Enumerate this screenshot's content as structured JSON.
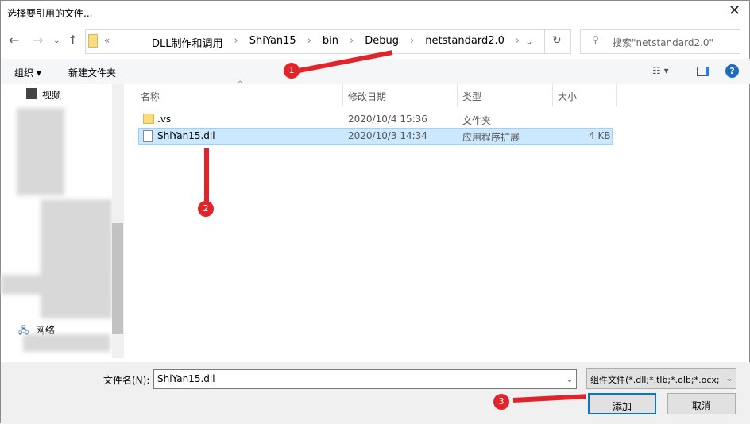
{
  "window": {
    "title": "选择要引用的文件..."
  },
  "address": {
    "overflow": "«",
    "crumbs": [
      "DLL制作和调用",
      "ShiYan15",
      "bin",
      "Debug",
      "netstandard2.0"
    ]
  },
  "search": {
    "placeholder": "搜索\"netstandard2.0\""
  },
  "toolbar": {
    "organize": "组织 ▾",
    "new_folder": "新建文件夹"
  },
  "sidebar": {
    "items": [
      {
        "label": "视频"
      },
      {
        "label": "网络"
      }
    ]
  },
  "columns": {
    "name": "名称",
    "date": "修改日期",
    "type": "类型",
    "size": "大小"
  },
  "files": [
    {
      "name": ".vs",
      "date": "2020/10/4 15:36",
      "type": "文件夹",
      "size": "",
      "selected": false
    },
    {
      "name": "ShiYan15.dll",
      "date": "2020/10/3 14:34",
      "type": "应用程序扩展",
      "size": "4 KB",
      "selected": true
    }
  ],
  "footer": {
    "filename_label": "文件名(N):",
    "filename_value": "ShiYan15.dll",
    "filetype": "组件文件(*.dll;*.tlb;*.olb;*.ocx;",
    "add": "添加",
    "cancel": "取消"
  },
  "annotations": [
    "1",
    "2",
    "3"
  ],
  "colors": {
    "annotation": "#e0252a",
    "selection": "#cce8ff"
  }
}
